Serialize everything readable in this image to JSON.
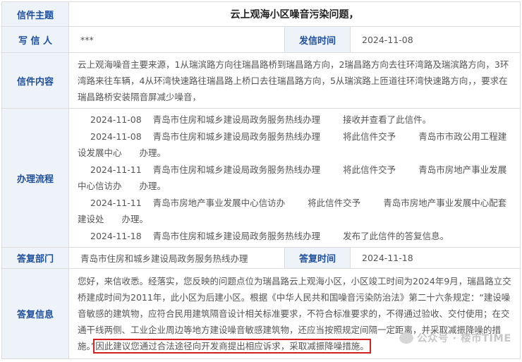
{
  "labels": {
    "subject": "信件主题",
    "writer": "写 信 人",
    "send_time": "发信时间",
    "content": "信件内容",
    "process": "办理流程",
    "dept": "答复部门",
    "reply_time": "答复时间",
    "reply": "答复信息"
  },
  "letter": {
    "subject": "云上观海小区噪音污染问题，",
    "writer": "***",
    "send_time": "2024-11-08",
    "content": "云上观海噪音主要来源，1从瑞滨路方向往瑞昌路桥到瑞昌路方向，2瑞昌路方向去往环湾路及瑞滨路方向，3环湾路来往车辆，4从环湾快速路往瑞昌路上桥口去往瑞昌路方向，5从瑞滨路上匝道往环湾快速路方向，，要求在瑞昌路桥安装隔音屏减少噪音，"
  },
  "process": [
    {
      "date": "2024-11-08",
      "actor": "青岛市住房和城乡建设局政务服务热线办理",
      "action": "接收并查看了此信件。",
      "target": ""
    },
    {
      "date": "2024-11-08",
      "actor": "青岛市住房和城乡建设局政务服务热线办理",
      "action": "将此信件交予",
      "target": "青岛市市政公用工程建设发展中心　　办理。"
    },
    {
      "date": "2024-11-11",
      "actor": "青岛市住房和城乡建设局政务服务热线办理",
      "action": "将此信件交予",
      "target": "青岛市房地产事业发展中心信访办　　办理。"
    },
    {
      "date": "2024-11-11",
      "actor": "青岛市房地产事业发展中心信访办",
      "action": "将此信件交予",
      "target": "青岛市房地产事业发展中心配套建设处　　办理。"
    },
    {
      "date": "2024-11-18",
      "actor": "青岛市住房和城乡建设局政务服务热线办理",
      "action": "发布了此信件的答复信息。",
      "target": ""
    }
  ],
  "reply": {
    "dept": "青岛市住房和城乡建设局政务服务热线办理",
    "time": "2024-11-18",
    "text": "您好，来信收悉。经落实，您反映的问题点位为瑞昌路云上观海小区，小区竣工时间为2024年9月，瑞昌路立交桥建成时间为2011年，此小区为后建小区。根据《中华人民共和国噪音污染防治法》第二十六条规定：“建设噪音敏感的建筑物，应符合民用建筑隔音设计相关标准要求，不符合标准要求的，不得通过验收、交付使用；在交通干线两侧、工业企业周边等地方建设噪音敏感建筑物，还应当按照规定间隔一定距离，并采取减振降噪的措施。”",
    "highlight": "因此建议您通过合法途径向开发商提出相应诉求，采取减振降噪措施。"
  },
  "watermark": {
    "text": "公众号 · 楼市TIME",
    "icon": "wechat-icon"
  }
}
